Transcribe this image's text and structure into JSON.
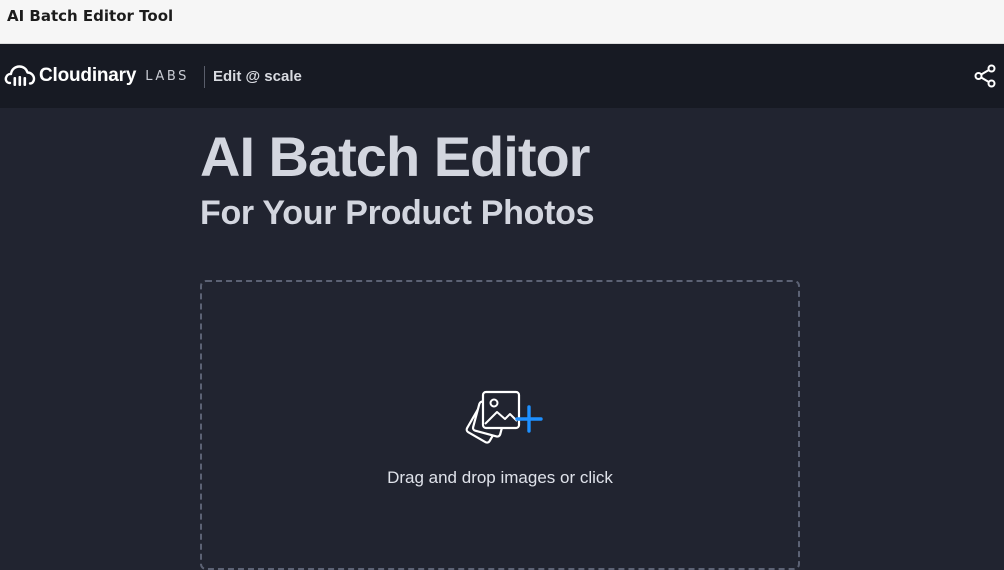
{
  "window": {
    "title": "AI Batch Editor Tool"
  },
  "navbar": {
    "brand": "Cloudinary",
    "labs": "LABS",
    "subtitle": "Edit @ scale",
    "logo_icon": "cloud-icon",
    "share_icon": "share-icon"
  },
  "hero": {
    "title": "AI Batch Editor",
    "subtitle": "For Your Product Photos"
  },
  "dropzone": {
    "icon": "add-images-icon",
    "text": "Drag and drop images or click"
  },
  "colors": {
    "background": "#212430",
    "navbar": "#171a23",
    "title_text": "#d3d6df",
    "accent_plus": "#1e90ff",
    "dropzone_border": "#5c6274"
  }
}
